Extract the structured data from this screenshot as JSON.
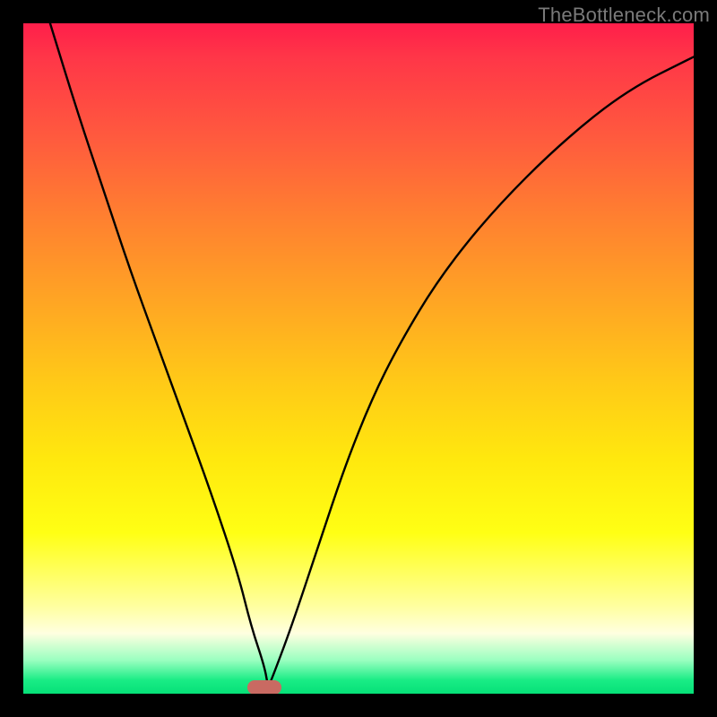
{
  "watermark": "TheBottleneck.com",
  "chart_data": {
    "type": "line",
    "title": "",
    "xlabel": "",
    "ylabel": "",
    "xlim": [
      0,
      100
    ],
    "ylim": [
      0,
      100
    ],
    "grid": false,
    "legend": false,
    "series": [
      {
        "name": "bottleneck-curve",
        "x": [
          4,
          8,
          12,
          16,
          20,
          24,
          28,
          32,
          34,
          36,
          36.5,
          37,
          40,
          44,
          48,
          52,
          56,
          62,
          70,
          80,
          90,
          100
        ],
        "y": [
          100,
          87,
          75,
          63,
          52,
          41,
          30,
          18,
          10,
          4,
          1,
          2,
          10,
          22,
          34,
          44,
          52,
          62,
          72,
          82,
          90,
          95
        ],
        "stroke": "#000000",
        "stroke_width": 2
      }
    ],
    "marker": {
      "x": 36,
      "y": 1,
      "shape": "rounded-rect",
      "color": "#c96a62"
    },
    "gradient_stops": [
      {
        "pos": 0,
        "color": "#ff1e4a"
      },
      {
        "pos": 17,
        "color": "#ff5a3e"
      },
      {
        "pos": 41,
        "color": "#ffa424"
      },
      {
        "pos": 65,
        "color": "#ffe80e"
      },
      {
        "pos": 87,
        "color": "#ffffa0"
      },
      {
        "pos": 95,
        "color": "#9affc0"
      },
      {
        "pos": 100,
        "color": "#06e078"
      }
    ]
  }
}
